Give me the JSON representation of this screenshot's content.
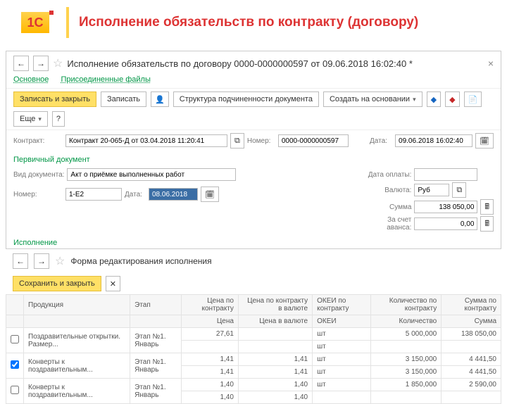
{
  "header": {
    "title": "Исполнение обязательств по контракту (договору)",
    "logo": "1С"
  },
  "panel1": {
    "title": "Исполнение обязательств по договору 0000-0000000597 от 09.06.2018 16:02:40 *",
    "links": {
      "main": "Основное",
      "attached": "Присоединенные файлы"
    },
    "toolbar": {
      "save_close": "Записать и закрыть",
      "save": "Записать",
      "struct": "Структура подчиненности документа",
      "create_on": "Создать на основании",
      "more": "Еще"
    },
    "contract_label": "Контракт:",
    "contract_value": "Контракт 20-065-Д от 03.04.2018 11:20:41",
    "number_label": "Номер:",
    "number_value": "0000-0000000597",
    "date_label": "Дата:",
    "date_value": "09.06.2018 16:02:40",
    "primary_doc": "Первичный документ",
    "doc_type_label": "Вид документа:",
    "doc_type_value": "Акт о приёмке выполненных работ",
    "num2_label": "Номер:",
    "num2_value": "1-Е2",
    "date2_label": "Дата:",
    "date2_value": "08.06.2018",
    "right": {
      "pay_date": "Дата оплаты:",
      "currency": "Валюта:",
      "currency_val": "Руб",
      "sum": "Сумма",
      "sum_val": "138 050,00",
      "advance": "За счет аванса:",
      "advance_val": "0,00"
    },
    "execution": "Исполнение"
  },
  "panel2": {
    "title": "Форма редактирования исполнения",
    "save_close": "Сохранить и закрыть",
    "headers": {
      "prod": "Продукция",
      "stage": "Этап",
      "price_c": "Цена по контракту",
      "price_cv": "Цена по контракту в валюте",
      "okei_c": "ОКЕИ по контракту",
      "qty_c": "Количество по контракту",
      "sum_c": "Сумма по контракту",
      "price": "Цена",
      "price_v": "Цена в валюте",
      "okei": "ОКЕИ",
      "qty": "Количество",
      "sum": "Сумма"
    },
    "rows": [
      {
        "chk": false,
        "prod": "Поздравительные открытки. Размер...",
        "stage": "Этап №1. Январь",
        "pc": "27,61",
        "pcv": "",
        "okei_top": "шт",
        "okei_bot": "шт",
        "qty": "5 000,000",
        "sum": "138 050,00"
      },
      {
        "chk": true,
        "prod": "Конверты к поздравительным...",
        "stage": "Этап №1. Январь",
        "pc": "1,41",
        "pcv": "1,41",
        "okei_top": "шт",
        "okei_bot": "шт",
        "qty": "3 150,000",
        "qty2": "3 150,000",
        "sum": "4 441,50",
        "sum2": "4 441,50"
      },
      {
        "chk": false,
        "prod": "Конверты к поздравительным...",
        "stage": "Этап №1. Январь",
        "pc": "1,40",
        "pcv": "1,40",
        "okei_top": "шт",
        "okei_bot": "",
        "qty": "1 850,000",
        "sum": "2 590,00"
      }
    ]
  }
}
